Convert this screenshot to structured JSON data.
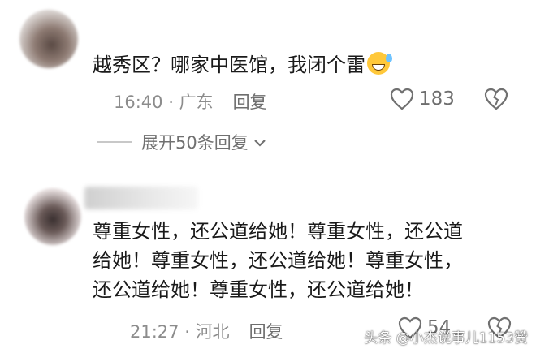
{
  "comments": [
    {
      "text": "越秀区？哪家中医馆，我闭个雷",
      "emoji": "sweat-smile-emoji",
      "time": "16:40",
      "location": "广东",
      "reply_label": "回复",
      "likes": "183",
      "expand_label": "展开50条回复"
    },
    {
      "lines": [
        "尊重女性，还公道给她！尊重女性，还公道",
        "给她！尊重女性，还公道给她！尊重女性，",
        "还公道给她！尊重女性，还公道给她！"
      ],
      "time": "21:27",
      "location": "河北",
      "reply_label": "回复",
      "likes": "54"
    }
  ],
  "separator": " · ",
  "watermark": "头条 @小杰说事儿1153赞",
  "colors": {
    "text": "#1a1a1a",
    "meta": "#8c8c8c",
    "background": "#ffffff"
  }
}
